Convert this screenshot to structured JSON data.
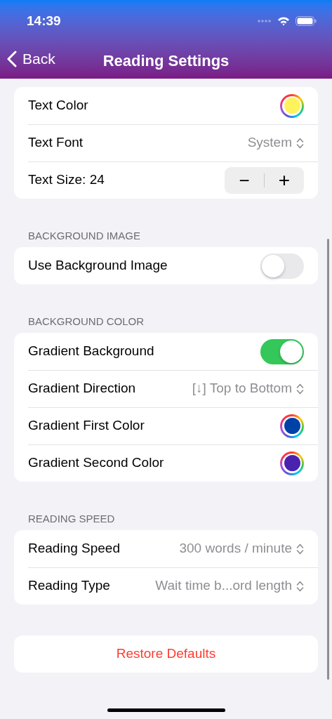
{
  "status_bar": {
    "time": "14:39"
  },
  "nav": {
    "back": "Back",
    "title": "Reading Settings"
  },
  "sections": [
    {
      "rows": [
        {
          "kind": "color",
          "label": "Text Color",
          "color": "#fff35c"
        },
        {
          "kind": "picker",
          "label": "Text Font",
          "value": "System"
        },
        {
          "kind": "stepper",
          "label": "Text Size: 24",
          "minus": "−",
          "plus": "+"
        }
      ]
    },
    {
      "header": "BACKGROUND IMAGE",
      "rows": [
        {
          "kind": "toggle",
          "label": "Use Background Image",
          "on": false
        }
      ]
    },
    {
      "header": "BACKGROUND COLOR",
      "rows": [
        {
          "kind": "toggle",
          "label": "Gradient Background",
          "on": true
        },
        {
          "kind": "picker",
          "label": "Gradient Direction",
          "value": "[↓] Top to Bottom"
        },
        {
          "kind": "color",
          "label": "Gradient First Color",
          "color": "#0041a8"
        },
        {
          "kind": "color",
          "label": "Gradient Second Color",
          "color": "#4a22b0"
        }
      ]
    },
    {
      "header": "READING SPEED",
      "rows": [
        {
          "kind": "picker",
          "label": "Reading Speed",
          "value": "300 words / minute"
        },
        {
          "kind": "picker",
          "label": "Reading Type",
          "value": "Wait time b...ord length"
        }
      ]
    }
  ],
  "restore_button": "Restore Defaults"
}
